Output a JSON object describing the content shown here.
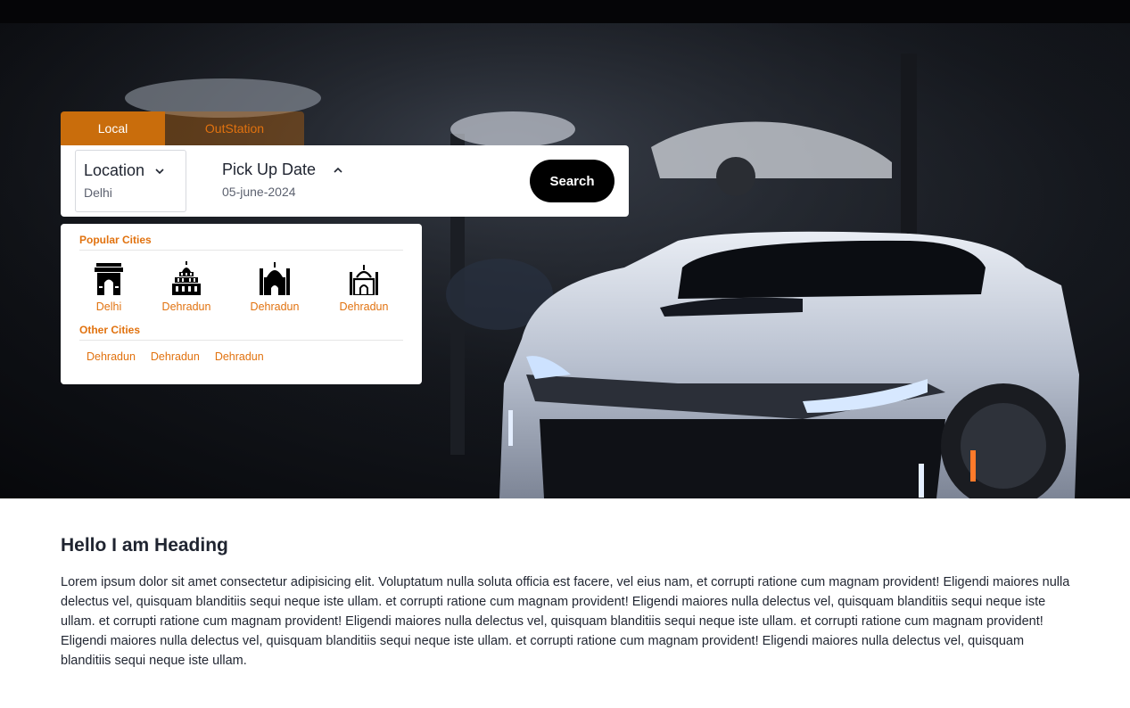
{
  "tabs": {
    "local": "Local",
    "outstation": "OutStation"
  },
  "search": {
    "location_label": "Location",
    "location_value": "Delhi",
    "date_label": "Pick Up Date",
    "date_value": "05-june-2024",
    "button": "Search"
  },
  "dropdown": {
    "popular_title": "Popular Cities",
    "popular": [
      {
        "label": "Delhi",
        "icon": "india-gate-icon"
      },
      {
        "label": "Dehradun",
        "icon": "temple-icon"
      },
      {
        "label": "Dehradun",
        "icon": "mosque-icon"
      },
      {
        "label": "Dehradun",
        "icon": "mosque-outline-icon"
      }
    ],
    "other_title": "Other Cities",
    "other": [
      "Dehradun",
      "Dehradun",
      "Dehradun"
    ]
  },
  "content": {
    "heading": "Hello I am Heading",
    "body": "Lorem ipsum dolor sit amet consectetur adipisicing elit. Voluptatum nulla soluta officia est facere, vel eius nam, et corrupti ratione cum magnam provident! Eligendi maiores nulla delectus vel, quisquam blanditiis sequi neque iste ullam. et corrupti ratione cum magnam provident! Eligendi maiores nulla delectus vel, quisquam blanditiis sequi neque iste ullam. et corrupti ratione cum magnam provident! Eligendi maiores nulla delectus vel, quisquam blanditiis sequi neque iste ullam. et corrupti ratione cum magnam provident! Eligendi maiores nulla delectus vel, quisquam blanditiis sequi neque iste ullam. et corrupti ratione cum magnam provident! Eligendi maiores nulla delectus vel, quisquam blanditiis sequi neque iste ullam."
  },
  "colors": {
    "accent": "#e1720f",
    "tab_active": "#c96d0c",
    "button": "#000000"
  }
}
